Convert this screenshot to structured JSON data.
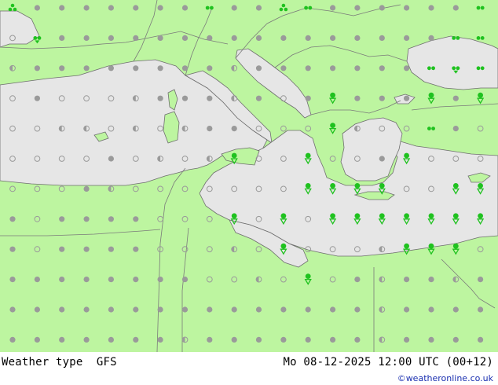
{
  "caption": {
    "product": "Weather type",
    "model": "GFS",
    "valid_time": "Mo 08-12-2025 12:00 UTC (00+12)"
  },
  "credit": "©weatheronline.co.uk",
  "colors": {
    "land": "#bdf5a0",
    "sea": "#e6e6e6",
    "border": "#7a7a7a",
    "coast": "#6e6e6e",
    "marker_gray": "#9a9a9a",
    "marker_green": "#1fc21f",
    "credit_text": "#1a2fb0"
  },
  "legend_symbols": {
    "filled_dot": "overcast",
    "half_dot": "partly cloudy",
    "open_circle": "clear",
    "green_arrow": "showers",
    "green_double_dot": "rain",
    "green_clover": "snow/drizzle cluster"
  },
  "grid": {
    "columns": 20,
    "rows": 12,
    "rows_codes": [
      "c d d d d d d d r d d c r d d d d d d r",
      "o f d d d d d d d d d d d d d d d d r r",
      "h d d d d d d d d h d d d d d d d r f r",
      "o d o o o h d d d h d o d s d d d s d s",
      "o o h h o h o h d d o o o s h o o r d o",
      "o o o o d o h o h s o o s o o d s o o o",
      "o o o d h o o o o o o o s s s s o o s s",
      "d o d d d d o o o s o s o s s s s s s s",
      "d o d d d d o o o h o s o o o h s s s o",
      "d d d d d d d d o o h o s o d h d d h d",
      "d d d d d d d d d d d d d d d h d d d d",
      "d d d d d d d h d d d d d d d h d d d d"
    ]
  }
}
